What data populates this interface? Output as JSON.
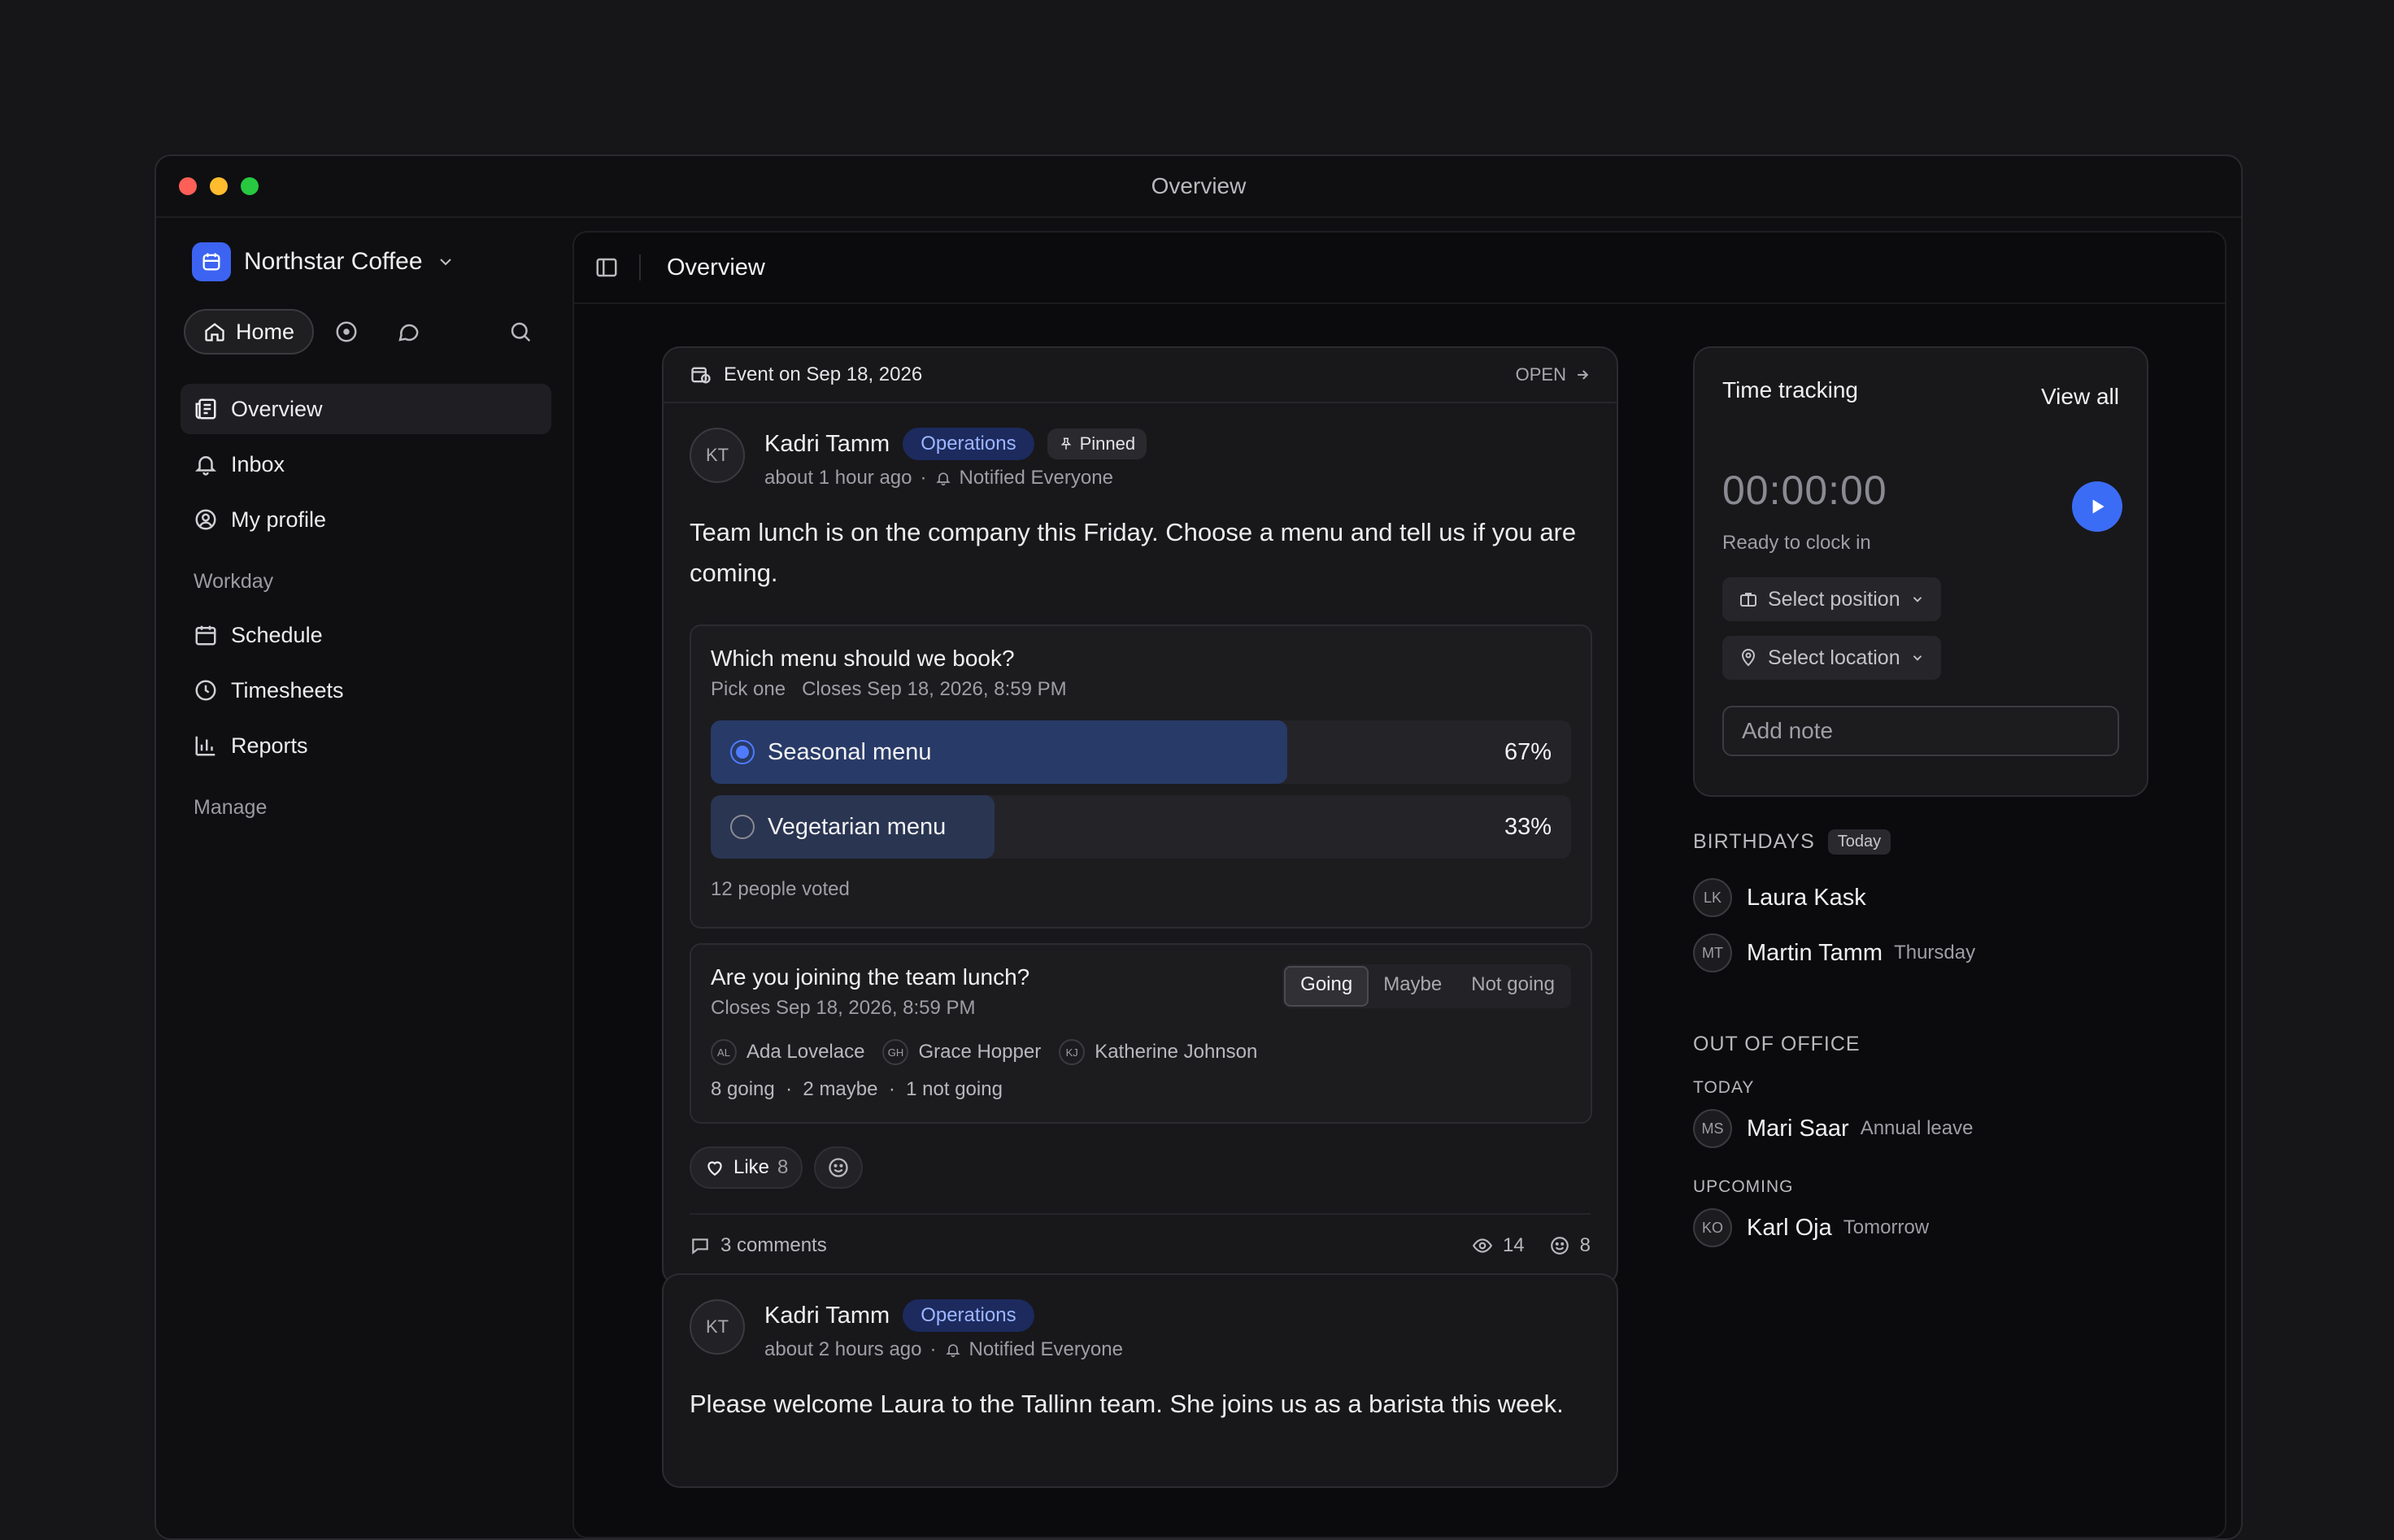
{
  "window": {
    "title": "Overview"
  },
  "sidebar": {
    "org_name": "Northstar Coffee",
    "home_label": "Home",
    "nav": [
      {
        "label": "Overview"
      },
      {
        "label": "Inbox"
      },
      {
        "label": "My profile"
      }
    ],
    "workday_title": "Workday",
    "workday": [
      {
        "label": "Schedule"
      },
      {
        "label": "Timesheets"
      },
      {
        "label": "Reports"
      }
    ],
    "manage_title": "Manage"
  },
  "main": {
    "breadcrumb": "Overview"
  },
  "post1": {
    "event_label": "Event on Sep 18, 2026",
    "open_label": "OPEN",
    "author_initials": "KT",
    "author": "Kadri Tamm",
    "team": "Operations",
    "pinned": "Pinned",
    "time": "about 1 hour ago",
    "notified": "Notified Everyone",
    "text": "Team lunch is on the company this Friday. Choose a menu and tell us if you are coming.",
    "poll": {
      "question": "Which menu should we book?",
      "mode": "Pick one",
      "closes": "Closes Sep 18, 2026, 8:59 PM",
      "options": [
        {
          "label": "Seasonal menu",
          "percent": "67%",
          "fraction": 0.67,
          "selected": true
        },
        {
          "label": "Vegetarian menu",
          "percent": "33%",
          "fraction": 0.33,
          "selected": false
        }
      ],
      "votes": "12 people voted"
    },
    "rsvp": {
      "question": "Are you joining the team lunch?",
      "closes": "Closes Sep 18, 2026, 8:59 PM",
      "choices": [
        "Going",
        "Maybe",
        "Not going"
      ],
      "selected": "Going",
      "attendees": [
        {
          "initials": "AL",
          "name": "Ada Lovelace"
        },
        {
          "initials": "GH",
          "name": "Grace Hopper"
        },
        {
          "initials": "KJ",
          "name": "Katherine Johnson"
        }
      ],
      "going": "8 going",
      "maybe": "2 maybe",
      "not_going": "1 not going"
    },
    "like_label": "Like",
    "like_count": "8",
    "comments": "3 comments",
    "views": "14",
    "reactions": "8"
  },
  "post2": {
    "author_initials": "KT",
    "author": "Kadri Tamm",
    "team": "Operations",
    "time": "about 2 hours ago",
    "notified": "Notified Everyone",
    "text": "Please welcome Laura to the Tallinn team. She joins us as a barista this week."
  },
  "time_tracking": {
    "title": "Time tracking",
    "view_all": "View all",
    "timer": "00:00:00",
    "status": "Ready to clock in",
    "position_placeholder": "Select position",
    "location_placeholder": "Select location",
    "note_placeholder": "Add note"
  },
  "birthdays": {
    "title": "BIRTHDAYS",
    "badge": "Today",
    "people": [
      {
        "initials": "LK",
        "name": "Laura Kask",
        "note": ""
      },
      {
        "initials": "MT",
        "name": "Martin Tamm",
        "note": "Thursday"
      }
    ]
  },
  "out_of_office": {
    "title": "OUT OF OFFICE",
    "today_label": "TODAY",
    "today": [
      {
        "initials": "MS",
        "name": "Mari Saar",
        "note": "Annual leave"
      }
    ],
    "upcoming_label": "UPCOMING",
    "upcoming": [
      {
        "initials": "KO",
        "name": "Karl Oja",
        "note": "Tomorrow"
      }
    ]
  },
  "colors": {
    "accent": "#3b6cf5",
    "team_badge_bg": "#1c2a5e",
    "team_badge_text": "#9db6ff"
  }
}
